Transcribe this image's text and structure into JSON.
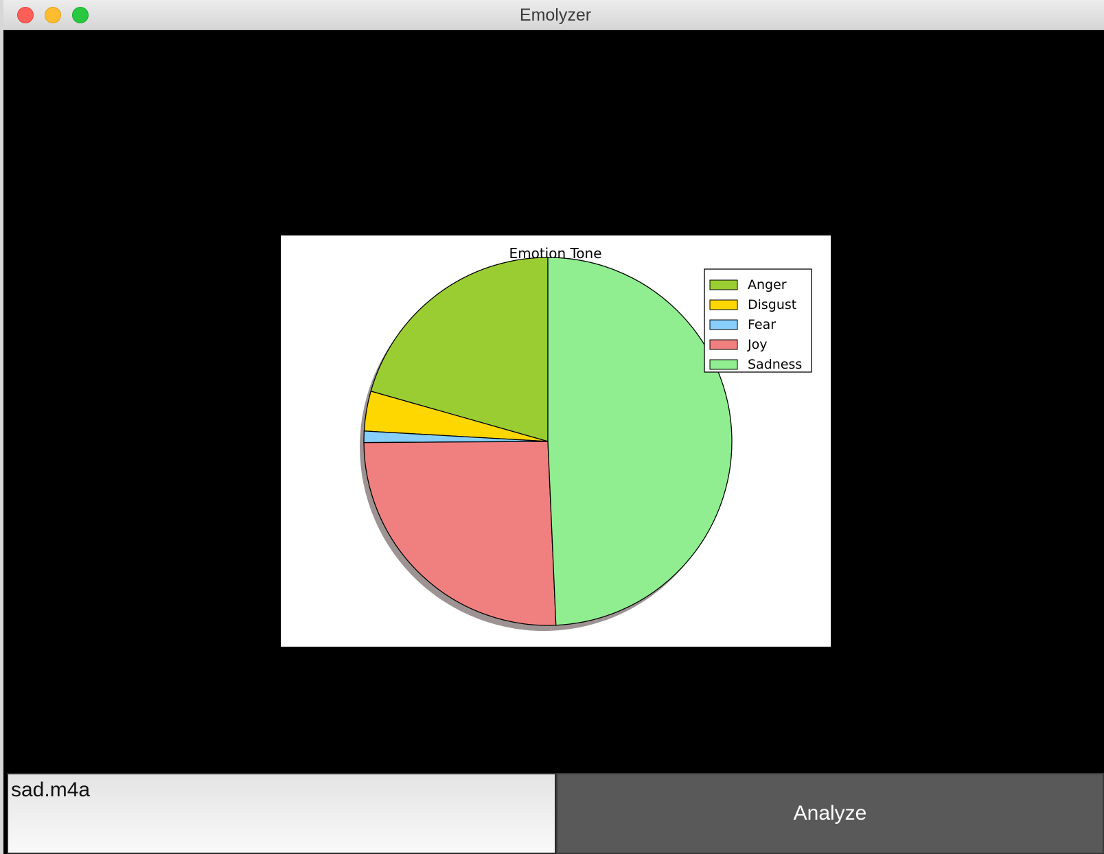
{
  "window": {
    "title": "Emolyzer"
  },
  "file_field": {
    "value": "sad.m4a"
  },
  "analyze_button": {
    "label": "Analyze"
  },
  "chart_data": {
    "type": "pie",
    "title": "Emotion Tone",
    "categories": [
      "Anger",
      "Disgust",
      "Fear",
      "Joy",
      "Sadness"
    ],
    "values": [
      20.6,
      3.5,
      1.0,
      25.6,
      49.3
    ],
    "colors": [
      "#9acd32",
      "#ffd700",
      "#87cefa",
      "#f08080",
      "#90ee90"
    ],
    "start_angle_deg": 90,
    "direction": "counterclockwise",
    "shadow": true,
    "legend": {
      "position": "top-right",
      "entries": [
        "Anger",
        "Disgust",
        "Fear",
        "Joy",
        "Sadness"
      ]
    }
  }
}
